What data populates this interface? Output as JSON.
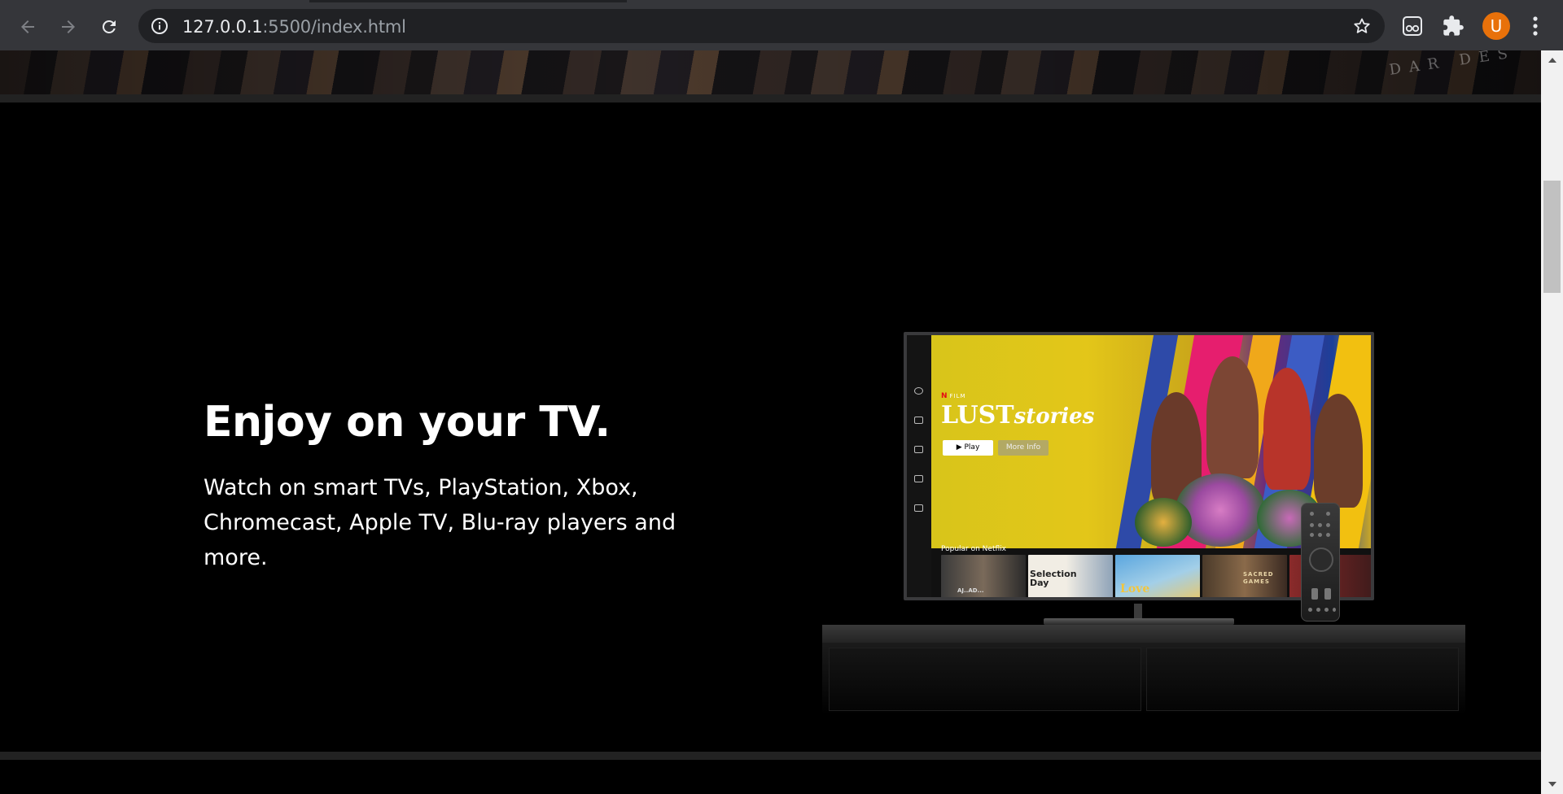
{
  "browser": {
    "url_host": "127.0.0.1",
    "url_path": ":5500/index.html",
    "profile_initial": "U",
    "accent_color": "#e8710a",
    "icons": {
      "back": "arrow-left-icon",
      "forward": "arrow-right-icon",
      "reload": "reload-icon",
      "site_info": "info-icon",
      "bookmark": "star-icon",
      "extension_1": "glasses-icon",
      "extensions": "puzzle-icon",
      "menu": "kebab-menu-icon"
    }
  },
  "page": {
    "banner_text": "DAR DES",
    "story": {
      "title": "Enjoy on your TV.",
      "subtitle": "Watch on smart TVs, PlayStation, Xbox, Chromecast, Apple TV, Blu-ray players and more."
    },
    "tv": {
      "film_tag": "FILM",
      "show_title_main": "LUST",
      "show_title_script": "stories",
      "play_label": "Play",
      "more_info_label": "More Info",
      "row_title": "Popular on Netflix",
      "thumbnails": [
        {
          "label": "AJ..AD..."
        },
        {
          "label": "Selection Day"
        },
        {
          "label": "Love"
        },
        {
          "label": "SACRED GAMES"
        }
      ],
      "brand_color": "#e50914"
    }
  }
}
